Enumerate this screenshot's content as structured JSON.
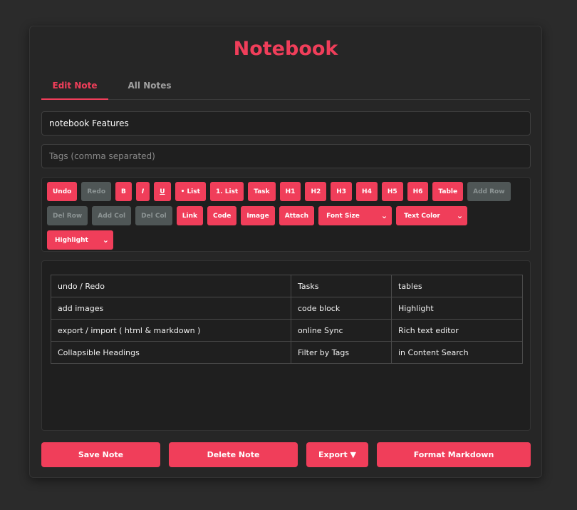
{
  "app": {
    "title": "Notebook",
    "accent": "#f03e5a"
  },
  "tabs": [
    {
      "label": "Edit Note",
      "active": true
    },
    {
      "label": "All Notes",
      "active": false
    }
  ],
  "note": {
    "title_value": "notebook Features",
    "tags_value": "",
    "tags_placeholder": "Tags (comma separated)"
  },
  "toolbar": {
    "buttons": [
      {
        "label": "Undo",
        "enabled": true
      },
      {
        "label": "Redo",
        "enabled": false
      },
      {
        "label": "B",
        "enabled": true
      },
      {
        "label": "I",
        "enabled": true
      },
      {
        "label": "U",
        "enabled": true
      },
      {
        "label": "• List",
        "enabled": true
      },
      {
        "label": "1. List",
        "enabled": true
      },
      {
        "label": "Task",
        "enabled": true
      },
      {
        "label": "H1",
        "enabled": true
      },
      {
        "label": "H2",
        "enabled": true
      },
      {
        "label": "H3",
        "enabled": true
      },
      {
        "label": "H4",
        "enabled": true
      },
      {
        "label": "H5",
        "enabled": true
      },
      {
        "label": "H6",
        "enabled": true
      },
      {
        "label": "Table",
        "enabled": true
      },
      {
        "label": "Add Row",
        "enabled": false
      },
      {
        "label": "Del Row",
        "enabled": false
      },
      {
        "label": "Add Col",
        "enabled": false
      },
      {
        "label": "Del Col",
        "enabled": false
      },
      {
        "label": "Link",
        "enabled": true
      },
      {
        "label": "Code",
        "enabled": true
      },
      {
        "label": "Image",
        "enabled": true
      },
      {
        "label": "Attach",
        "enabled": true
      }
    ],
    "selects": {
      "font_size": "Font Size",
      "text_color": "Text Color",
      "highlight": "Highlight"
    },
    "chevron_icon": "chevron-down-icon"
  },
  "editor": {
    "table": [
      [
        "undo / Redo",
        "Tasks",
        "tables"
      ],
      [
        "add images",
        "code block",
        "Highlight"
      ],
      [
        "export / import ( html & markdown )",
        "online Sync",
        "Rich text editor"
      ],
      [
        "Collapsible Headings",
        "Filter by Tags",
        "in Content Search"
      ]
    ]
  },
  "actions": {
    "save": "Save Note",
    "delete": "Delete Note",
    "export": "Export ▼",
    "format": "Format Markdown"
  }
}
